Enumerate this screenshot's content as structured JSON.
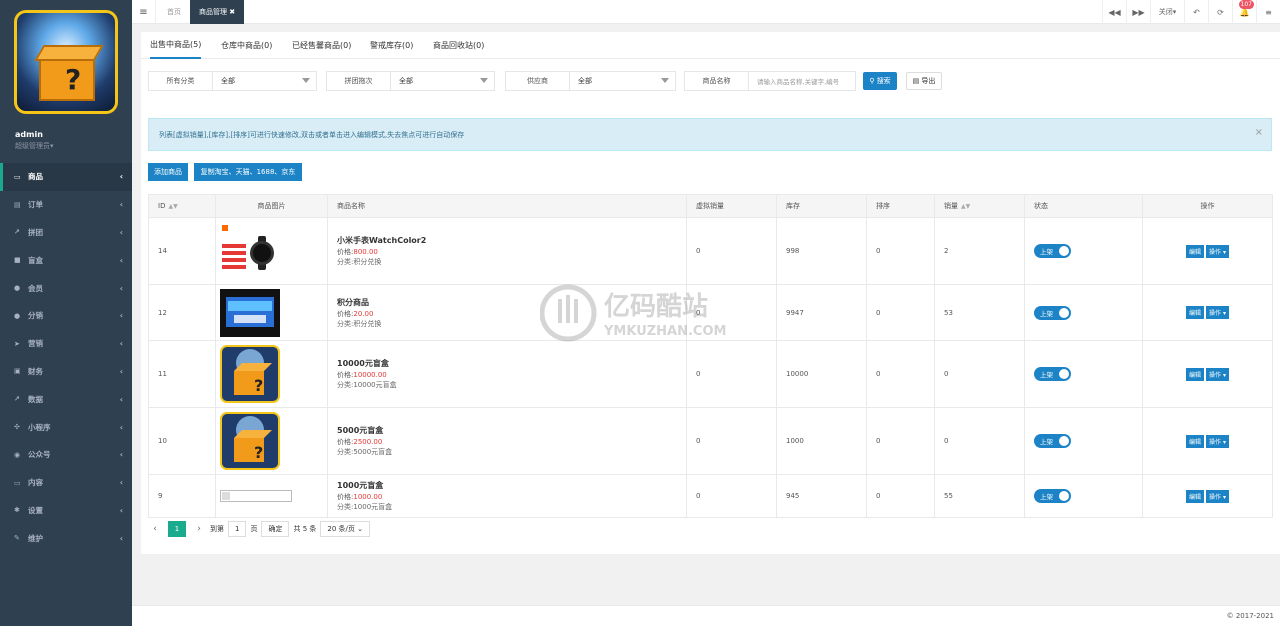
{
  "sidebar": {
    "user_name": "admin",
    "user_role": "超级管理员▾",
    "items": [
      {
        "label": "商品",
        "icon": "monitor-icon",
        "active": true
      },
      {
        "label": "订单",
        "icon": "document-icon"
      },
      {
        "label": "拼团",
        "icon": "line-chart-icon"
      },
      {
        "label": "盲盒",
        "icon": "square-icon"
      },
      {
        "label": "会员",
        "icon": "user-icon"
      },
      {
        "label": "分销",
        "icon": "users-icon"
      },
      {
        "label": "营销",
        "icon": "send-icon"
      },
      {
        "label": "财务",
        "icon": "money-icon"
      },
      {
        "label": "数据",
        "icon": "area-chart-icon"
      },
      {
        "label": "小程序",
        "icon": "network-icon"
      },
      {
        "label": "公众号",
        "icon": "wechat-icon"
      },
      {
        "label": "内容",
        "icon": "inbox-icon"
      },
      {
        "label": "设置",
        "icon": "gear-icon"
      },
      {
        "label": "维护",
        "icon": "wrench-icon"
      }
    ]
  },
  "topbar": {
    "menu_icon": "≡",
    "tabs": [
      "首页",
      "商品管理 ✖"
    ],
    "close_label": "关闭▾",
    "notification_count": "107"
  },
  "sub_tabs": [
    "出售中商品(5)",
    "仓库中商品(0)",
    "已经售馨商品(0)",
    "警戒库存(0)",
    "商品回收站(0)"
  ],
  "filters": {
    "category_label": "所有分类",
    "category_value": "全部",
    "group_label": "拼团拖次",
    "group_value": "全部",
    "supplier_label": "供应商",
    "supplier_value": "全部",
    "name_label": "商品名称",
    "name_placeholder": "请输入商品名称,关键字,编号",
    "search_button": "搜索",
    "export_button": "导出"
  },
  "alert_text": "列表[虚拟销量],[库存],[排序]可进行快速修改,双击或者单击进入编辑模式,失去焦点可进行自动保存",
  "actions": {
    "add": "添加商品",
    "copy": "复制淘宝、天猫、1688、京东"
  },
  "table": {
    "headers": [
      "ID",
      "商品图片",
      "商品名称",
      "虚拟销量",
      "库存",
      "排序",
      "销量",
      "状态",
      "操作"
    ],
    "rows": [
      {
        "id": "14",
        "image": "watch",
        "name": "小米手表WatchColor2",
        "price": "价格:",
        "price_value": "800.00",
        "category": "分类:积分兑换",
        "virtual": "0",
        "stock": "998",
        "sort": "0",
        "sales": "2",
        "status": "上架",
        "edit": "编辑",
        "op": "操作 ▾"
      },
      {
        "id": "12",
        "image": "product-box",
        "name": "积分商品",
        "price": "价格:",
        "price_value": "20.00",
        "category": "分类:积分兑换",
        "virtual": "0",
        "stock": "9947",
        "sort": "0",
        "sales": "53",
        "status": "上架",
        "edit": "编辑",
        "op": "操作 ▾"
      },
      {
        "id": "11",
        "image": "mystery-box",
        "name": "10000元盲盒",
        "price": "价格:",
        "price_value": "10000.00",
        "category": "分类:10000元盲盒",
        "virtual": "0",
        "stock": "10000",
        "sort": "0",
        "sales": "0",
        "status": "上架",
        "edit": "编辑",
        "op": "操作 ▾"
      },
      {
        "id": "10",
        "image": "mystery-box",
        "name": "5000元盲盒",
        "price": "价格:",
        "price_value": "2500.00",
        "category": "分类:5000元盲盒",
        "virtual": "0",
        "stock": "1000",
        "sort": "0",
        "sales": "0",
        "status": "上架",
        "edit": "编辑",
        "op": "操作 ▾"
      },
      {
        "id": "9",
        "image": "broken",
        "name": "1000元盲盒",
        "price": "价格:",
        "price_value": "1000.00",
        "category": "分类:1000元盲盒",
        "virtual": "0",
        "stock": "945",
        "sort": "0",
        "sales": "55",
        "status": "上架",
        "edit": "编辑",
        "op": "操作 ▾"
      }
    ]
  },
  "pager": {
    "prev": "‹",
    "current": "1",
    "next": "›",
    "goto": "到第",
    "page_input": "1",
    "page_unit": "页",
    "confirm": "确定",
    "total": "共 5 条",
    "per_page": "20 条/页"
  },
  "watermark": {
    "cn": "亿码酷站",
    "en": "YMKUZHAN.COM"
  },
  "footer": "© 2017-2021"
}
